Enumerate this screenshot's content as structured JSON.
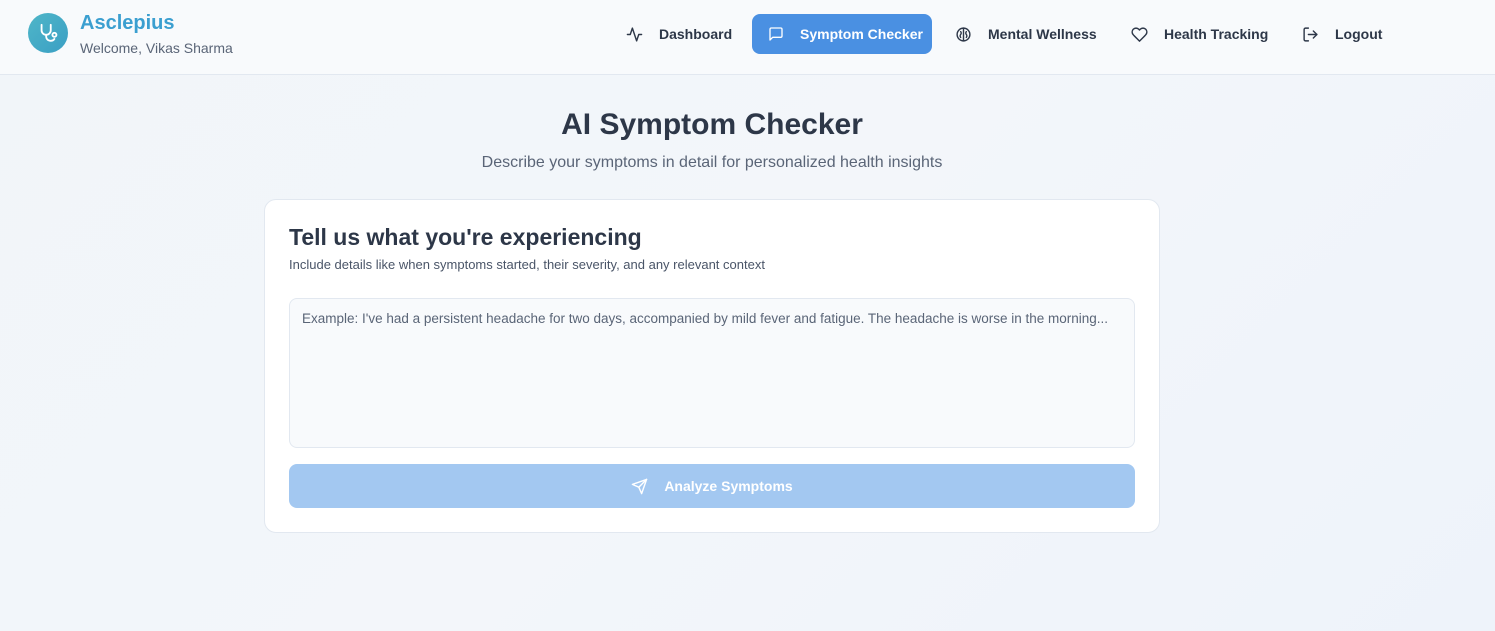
{
  "brand": {
    "name": "Asclepius",
    "welcome": "Welcome, Vikas Sharma",
    "logo_icon": "stethoscope-icon"
  },
  "nav": {
    "items": [
      {
        "label": "Dashboard",
        "icon": "activity-icon",
        "active": false
      },
      {
        "label": "Symptom Checker",
        "icon": "message-square-icon",
        "active": true
      },
      {
        "label": "Mental Wellness",
        "icon": "brain-icon",
        "active": false
      },
      {
        "label": "Health Tracking",
        "icon": "heart-icon",
        "active": false
      },
      {
        "label": "Logout",
        "icon": "logout-icon",
        "active": false
      }
    ]
  },
  "page": {
    "title": "AI Symptom Checker",
    "subtitle": "Describe your symptoms in detail for personalized health insights"
  },
  "card": {
    "title": "Tell us what you're experiencing",
    "hint": "Include details like when symptoms started, their severity, and any relevant context",
    "textarea_value": "",
    "textarea_placeholder": "Example: I've had a persistent headache for two days, accompanied by mild fever and fatigue. The headache is worse in the morning...",
    "button_label": "Analyze Symptoms",
    "button_icon": "send-icon",
    "button_disabled": true
  },
  "colors": {
    "brand": "#3b9fd0",
    "accent": "#4a90e2",
    "button_disabled": "#a3c8f1",
    "text_primary": "#2d3748",
    "text_secondary": "#5a6577"
  }
}
